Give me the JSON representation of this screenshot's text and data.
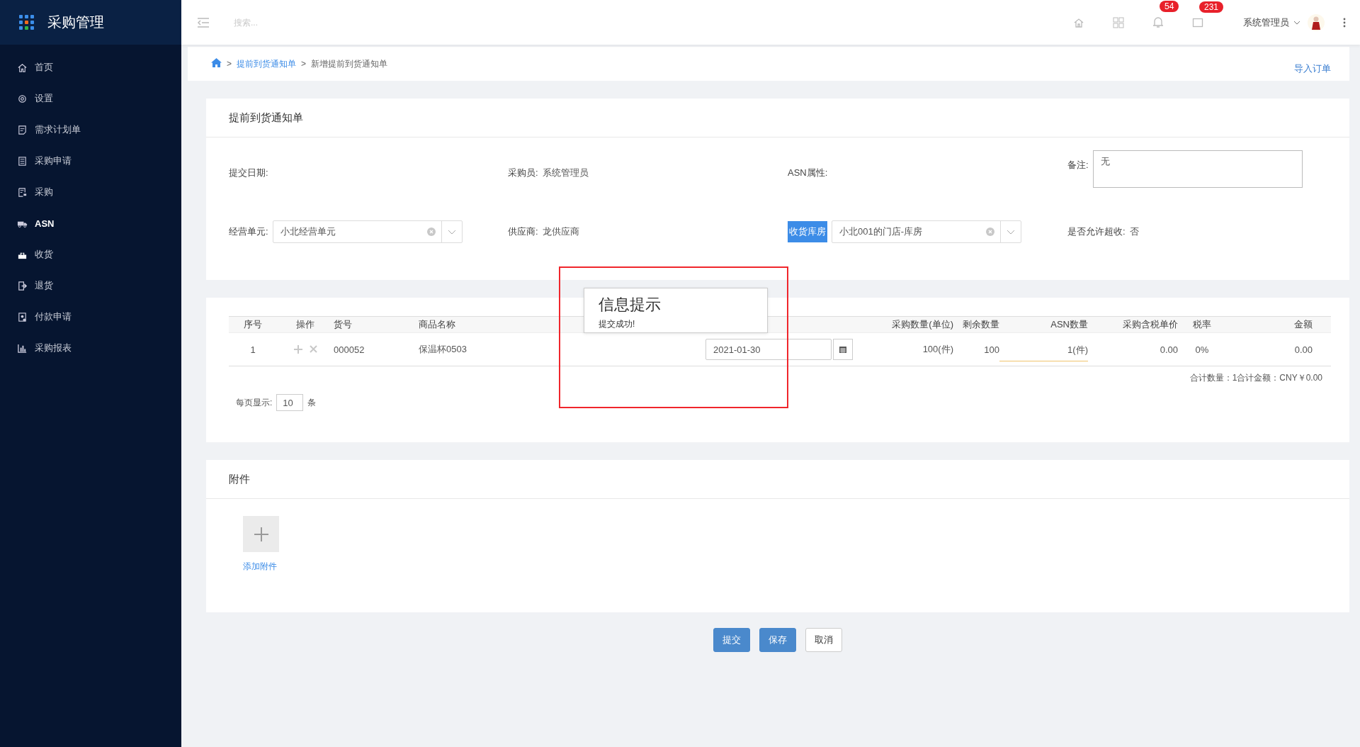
{
  "app": {
    "title": "采购管理"
  },
  "sidebar": {
    "items": [
      {
        "label": "首页",
        "selected": false
      },
      {
        "label": "设置",
        "selected": false
      },
      {
        "label": "需求计划单",
        "selected": false
      },
      {
        "label": "采购申请",
        "selected": false
      },
      {
        "label": "采购",
        "selected": false
      },
      {
        "label": "ASN",
        "selected": true
      },
      {
        "label": "收货",
        "selected": false
      },
      {
        "label": "退货",
        "selected": false
      },
      {
        "label": "付款申请",
        "selected": false
      },
      {
        "label": "采购报表",
        "selected": false
      }
    ]
  },
  "header": {
    "search": {
      "placeholder": "搜索..."
    },
    "bell_badge": "54",
    "message_badge": "231",
    "user": "系统管理员"
  },
  "breadcrumb": {
    "items": [
      {
        "label": "提前到货通知单",
        "link": true
      },
      {
        "label": "新增提前到货通知单",
        "link": false
      }
    ],
    "separator": ">",
    "action": "导入订单"
  },
  "form": {
    "title": "提前到货通知单",
    "fields": [
      {
        "kind": "text",
        "label": "提交日期:"
      },
      {
        "kind": "text",
        "label": "采购员:",
        "value": "系统管理员"
      },
      {
        "kind": "text",
        "label": "ASN属性:"
      },
      {
        "kind": "textarea",
        "label": "备注:",
        "value": "无"
      },
      {
        "kind": "select",
        "label": "经营单元:",
        "value": "小北经营单元",
        "highlighted": false
      },
      {
        "kind": "text",
        "label": "供应商:",
        "value": "龙供应商"
      },
      {
        "kind": "select",
        "label": "收货库房",
        "value": "小北001的门店-库房",
        "highlighted": true
      },
      {
        "kind": "text",
        "label": "是否允许超收:",
        "value": "否"
      }
    ]
  },
  "table": {
    "columns": [
      "序号",
      "操作",
      "货号",
      "商品名称",
      "采购数量(单位)",
      "剩余数量",
      "ASN数量",
      "采购含税单价",
      "税率",
      "金额"
    ],
    "rows": [
      {
        "index": "1",
        "sku": "000052",
        "name": "保温杯0503",
        "date": "2021-01-30",
        "qty": "100(件)",
        "remaining": "100",
        "asn_qty": "1(件)",
        "price": "0.00",
        "tax": "0%",
        "amount": "0.00"
      }
    ],
    "total": "合计数量：1合计金额：CNY￥0.00",
    "page_size_label": "每页显示:",
    "page_size": "10",
    "page_size_unit": "条"
  },
  "dialog": {
    "title": "信息提示",
    "message": "提交成功!"
  },
  "attachments": {
    "title": "附件",
    "add_label": "添加附件"
  },
  "buttons": [
    {
      "label": "提交",
      "primary": true
    },
    {
      "label": "保存",
      "primary": true
    },
    {
      "label": "取消",
      "primary": false
    }
  ]
}
